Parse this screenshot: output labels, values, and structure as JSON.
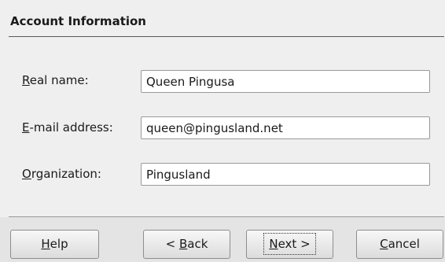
{
  "header": {
    "title": "Account Information"
  },
  "form": {
    "real_name": {
      "mnemonic": "R",
      "label_rest": "eal name:",
      "value": "Queen Pingusa"
    },
    "email": {
      "mnemonic": "E",
      "label_rest": "-mail address:",
      "value": "queen@pingusland.net"
    },
    "organization": {
      "mnemonic": "O",
      "label_rest": "rganization:",
      "value": "Pingusland"
    }
  },
  "buttons": {
    "help": {
      "mnemonic": "H",
      "rest": "elp"
    },
    "back": {
      "prefix": "< ",
      "mnemonic": "B",
      "rest": "ack"
    },
    "next": {
      "mnemonic": "N",
      "rest": "ext >"
    },
    "cancel": {
      "mnemonic": "C",
      "rest": "ancel"
    }
  }
}
